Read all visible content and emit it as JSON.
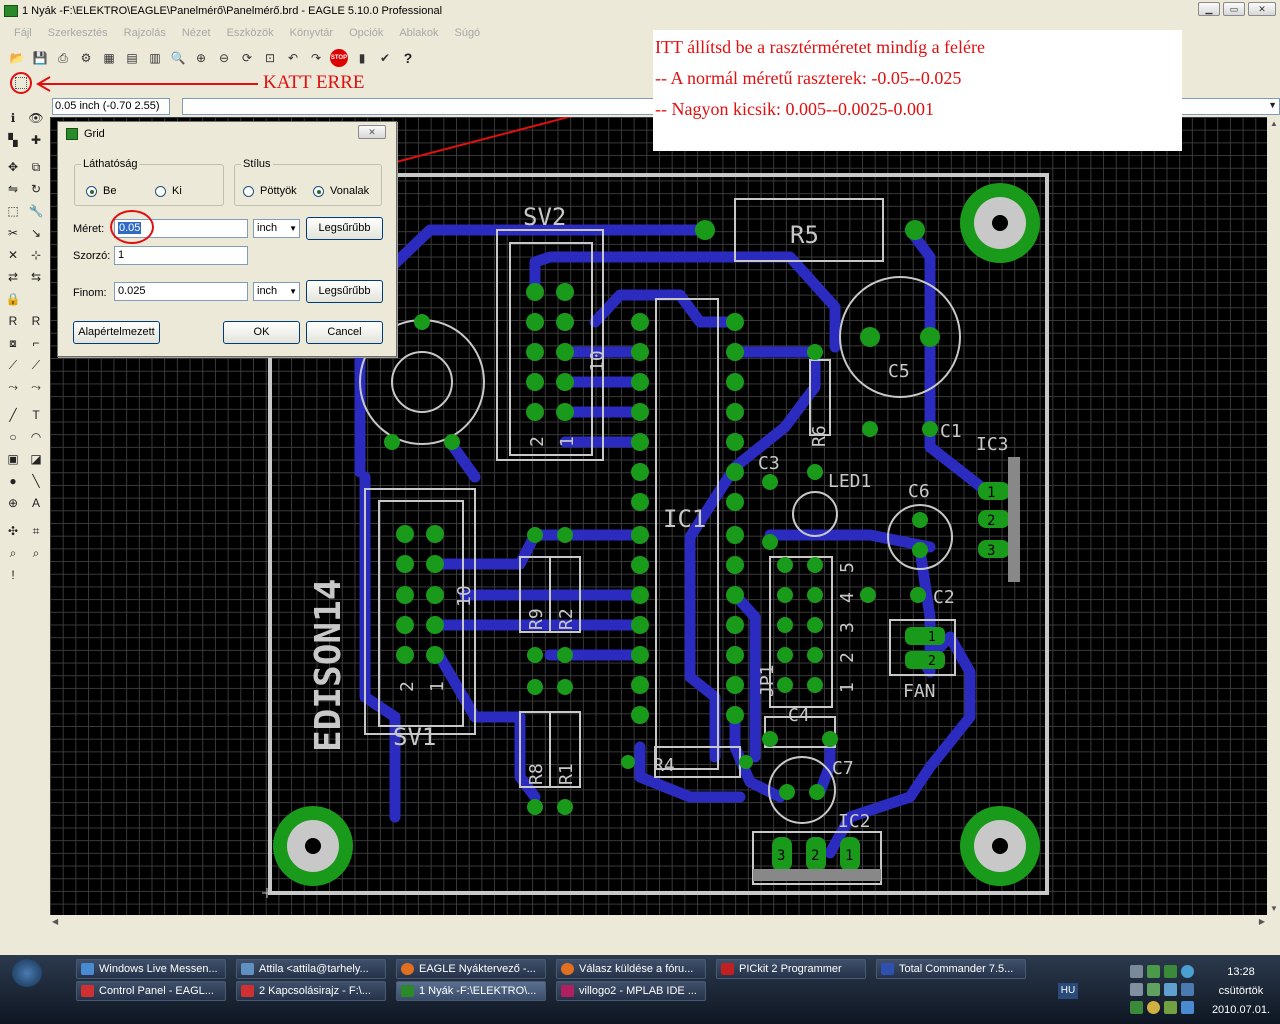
{
  "window": {
    "title": "1 Nyák -F:\\ELEKTRO\\EAGLE\\Panelmérő\\Panelmérő.brd - EAGLE 5.10.0 Professional"
  },
  "menu": [
    "Fájl",
    "Szerkesztés",
    "Rajzolás",
    "Nézet",
    "Eszközök",
    "Könyvtár",
    "Opciók",
    "Ablakok",
    "Súgó"
  ],
  "toolbar": {
    "stop_label": "STOP",
    "help_label": "?"
  },
  "annotation": {
    "katt": "KATT ERRE",
    "note_line1": "ITT állítsd be a rasztérméretet mindíg a felére",
    "note_line2": "-- A normál méretű raszterek: -0.05--0.025",
    "note_line3": "-- Nagyon kicsik: 0.005--0.0025-0.001"
  },
  "command": {
    "coord": "0.05 inch (-0.70 2.55)"
  },
  "dialog": {
    "title": "Grid",
    "visibility_legend": "Láthatóság",
    "visibility_on": "Be",
    "visibility_off": "Ki",
    "style_legend": "Stílus",
    "style_dots": "Pöttyök",
    "style_lines": "Vonalak",
    "size_label": "Méret:",
    "size_value": "0.05",
    "size_unit": "inch",
    "finest_label": "Legsűrűbb",
    "multiplier_label": "Szorzó:",
    "multiplier_value": "1",
    "fine_label": "Finom:",
    "fine_value": "0.025",
    "fine_unit": "inch",
    "finest2_label": "Legsűrűbb",
    "default_label": "Alapértelmezett",
    "ok_label": "OK",
    "cancel_label": "Cancel"
  },
  "board": {
    "labels": {
      "sv2": "SV2",
      "r5": "R5",
      "c5": "C5",
      "c1": "C1",
      "ic3": "IC3",
      "r6": "R6",
      "c3": "C3",
      "led1": "LED1",
      "c6": "C6",
      "ic1": "IC1",
      "c2": "C2",
      "fan": "FAN",
      "jp1": "JP1",
      "c4": "C4",
      "r4": "R4",
      "c7": "C7",
      "ic2": "IC2",
      "sv1": "SV1",
      "r9": "R9",
      "r2": "R2",
      "r8": "R8",
      "r1": "R1",
      "edison": "EDISON14",
      "sv2_10": "10",
      "sv2_2": "2",
      "sv2_1": "1",
      "sv1_10": "10",
      "sv1_2": "2",
      "sv1_1": "1",
      "jp_5": "5",
      "jp_4": "4",
      "jp_3": "3",
      "jp_2": "2",
      "jp_1": "1",
      "ic3_1": "1",
      "ic3_2": "2",
      "ic3_3": "3",
      "ic2_3": "3",
      "ic2_2": "2",
      "ic2_1": "1",
      "fan_1": "1",
      "fan_2": "2",
      "pot_3": "3"
    }
  },
  "taskbar": {
    "tasks": [
      "Windows Live Messen...",
      "Attila <attila@tarhely...",
      "EAGLE Nyáktervező -...",
      "Válasz küldése a fóru...",
      "PICkit 2 Programmer",
      "Total Commander 7.5...",
      "Control Panel - EAGL...",
      "2 Kapcsolásirajz - F:\\...",
      "1 Nyák -F:\\ELEKTRO\\...",
      "villogo2 - MPLAB IDE ..."
    ],
    "lang": "HU",
    "time": "13:28",
    "day": "csütörtök",
    "date": "2010.07.01."
  },
  "colors": {
    "annotation_red": "#e01010",
    "trace_blue": "#2b2bbf",
    "pad_green": "#1a9a1a",
    "silk_gray": "#c8c8c8"
  }
}
